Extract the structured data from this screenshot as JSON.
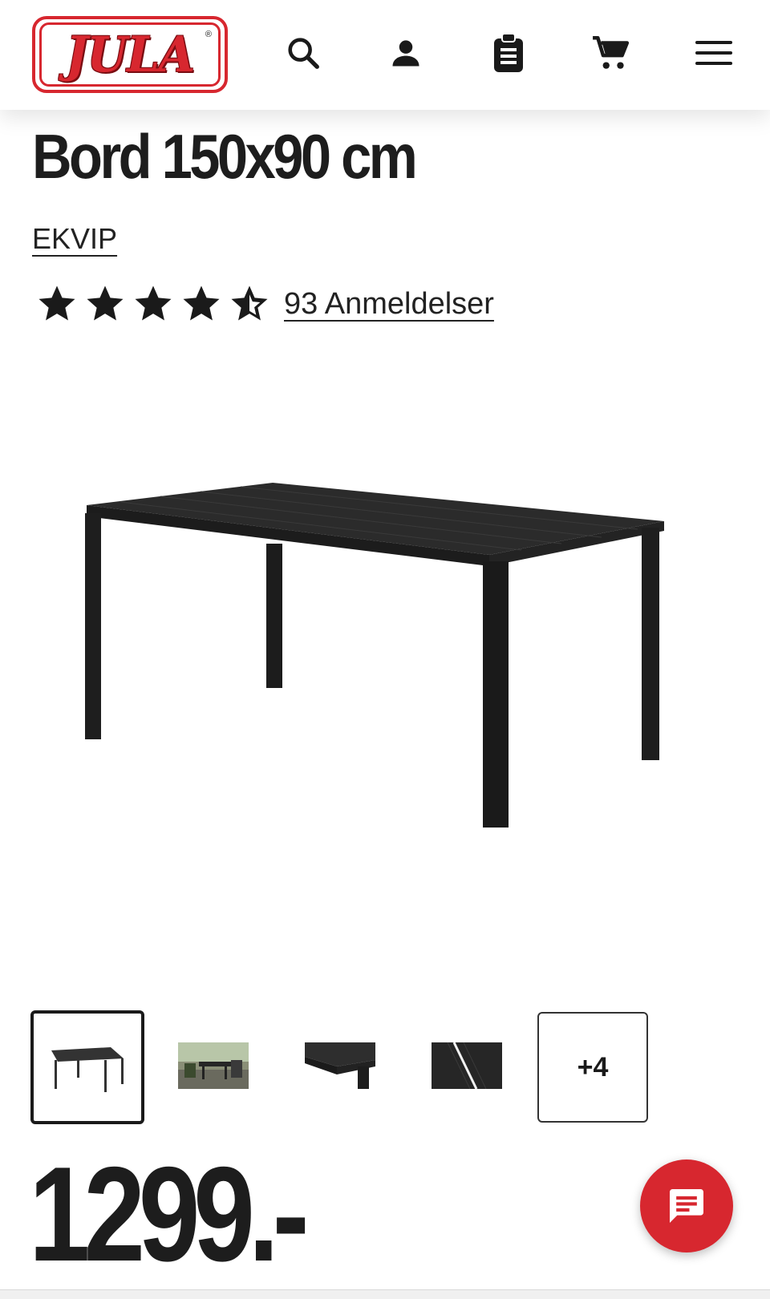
{
  "header": {
    "logo_text": "JULA",
    "logo_mark": "®",
    "icons": [
      "search-icon",
      "account-icon",
      "clipboard-list-icon",
      "cart-icon",
      "menu-icon"
    ]
  },
  "product": {
    "title": "Bord 150x90 cm",
    "brand": "EKVIP",
    "rating": 4.5,
    "rating_max": 5,
    "reviews_label": "93 Anmeldelser",
    "more_images_label": "+4",
    "price": "1299.-"
  },
  "colors": {
    "brand_red": "#d7272f",
    "text": "#1a1a1a"
  }
}
